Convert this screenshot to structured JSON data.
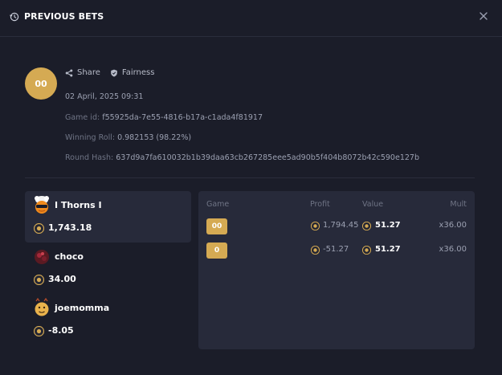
{
  "header": {
    "title": "PREVIOUS BETS"
  },
  "result": {
    "label": "00"
  },
  "links": {
    "share": "Share",
    "fairness": "Fairness"
  },
  "info": {
    "date": "02 April, 2025 09:31",
    "game_id_label": "Game id:",
    "game_id": "f55925da-7e55-4816-b17a-c1ada4f81917",
    "winning_label": "Winning Roll:",
    "winning": "0.982153 (98.22%)",
    "hash_label": "Round Hash:",
    "hash": "637d9a7fa610032b1b39daa63cb267285eee5ad90b5f404b8072b42c590e127b"
  },
  "players": [
    {
      "name": "I Thorns I",
      "amount": "1,743.18"
    },
    {
      "name": "choco",
      "amount": "34.00"
    },
    {
      "name": "joemomma",
      "amount": "-8.05"
    }
  ],
  "bets_table": {
    "headers": {
      "game": "Game",
      "profit": "Profit",
      "value": "Value",
      "mult": "Mult"
    },
    "rows": [
      {
        "game": "00",
        "profit": "1,794.45",
        "value": "51.27",
        "mult": "x36.00"
      },
      {
        "game": "0",
        "profit": "-51.27",
        "value": "51.27",
        "mult": "x36.00"
      }
    ]
  },
  "colors": {
    "accent": "#d5aa53",
    "background": "#1b1d29",
    "panel": "#272a3a"
  },
  "icons": [
    "history-icon",
    "close-icon",
    "share-icon",
    "shield-check-icon",
    "coin-icon"
  ]
}
